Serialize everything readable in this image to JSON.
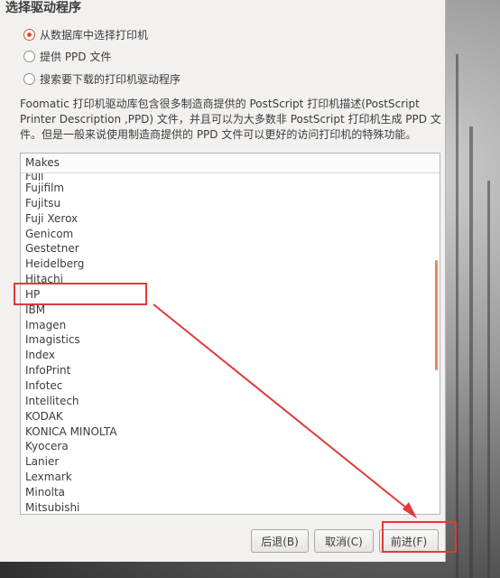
{
  "dialog": {
    "title": "选择驱动程序",
    "options": [
      {
        "label": "从数据库中选择打印机",
        "selected": true
      },
      {
        "label": "提供 PPD 文件",
        "selected": false
      },
      {
        "label": "搜索要下载的打印机驱动程序",
        "selected": false
      }
    ],
    "description": "Foomatic 打印机驱动库包含很多制造商提供的 PostScript 打印机描述(PostScript Printer Description ,PPD) 文件，并且可以为大多数非 PostScript 打印机生成 PPD 文件。但是一般来说使用制造商提供的 PPD 文件可以更好的访问打印机的特殊功能。",
    "list_header": "Makes",
    "makes": [
      "Fuji",
      "Fujifilm",
      "Fujitsu",
      "Fuji Xerox",
      "Genicom",
      "Gestetner",
      "Heidelberg",
      "Hitachi",
      "HP",
      "IBM",
      "Imagen",
      "Imagistics",
      "Index",
      "InfoPrint",
      "Infotec",
      "Intellitech",
      "KODAK",
      "KONICA MINOLTA",
      "Kyocera",
      "Lanier",
      "Lexmark",
      "Minolta",
      "Mitsubishi"
    ],
    "buttons": {
      "back": "后退(B)",
      "cancel": "取消(C)",
      "forward": "前进(F)"
    }
  },
  "colors": {
    "accent": "#d8502a",
    "annotation": "#e03a3a"
  }
}
